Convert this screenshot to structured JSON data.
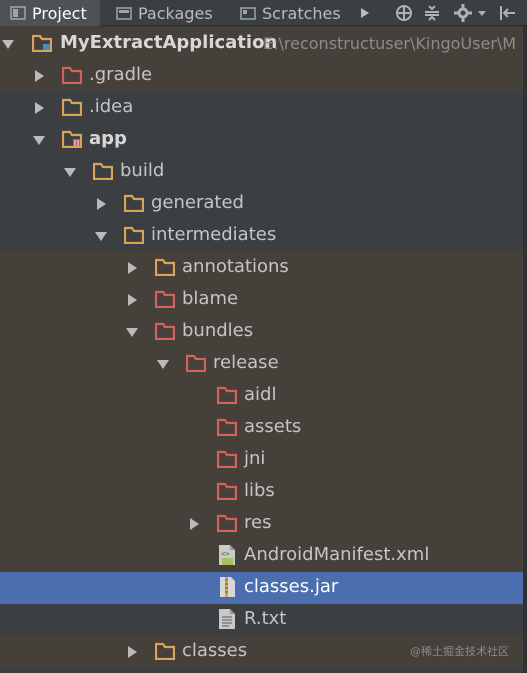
{
  "tabs": {
    "project": "Project",
    "packages": "Packages",
    "scratches": "Scratches"
  },
  "tree": {
    "root_label": "MyExtractApplication",
    "root_path": "E:\\reconstructuser\\KingoUser\\M",
    "gradle": ".gradle",
    "idea": ".idea",
    "app": "app",
    "build": "build",
    "generated": "generated",
    "intermediates": "intermediates",
    "annotations": "annotations",
    "blame": "blame",
    "bundles": "bundles",
    "release": "release",
    "aidl": "aidl",
    "assets": "assets",
    "jni": "jni",
    "libs": "libs",
    "res": "res",
    "manifest": "AndroidManifest.xml",
    "classes_jar": "classes.jar",
    "r_txt": "R.txt",
    "classes": "classes"
  },
  "watermark": "@稀土掘金技术社区",
  "colors": {
    "background": "#3c3f41",
    "selection": "#4b6eaf",
    "folder_yellow": "#d9a35a",
    "folder_red": "#d5625a"
  }
}
